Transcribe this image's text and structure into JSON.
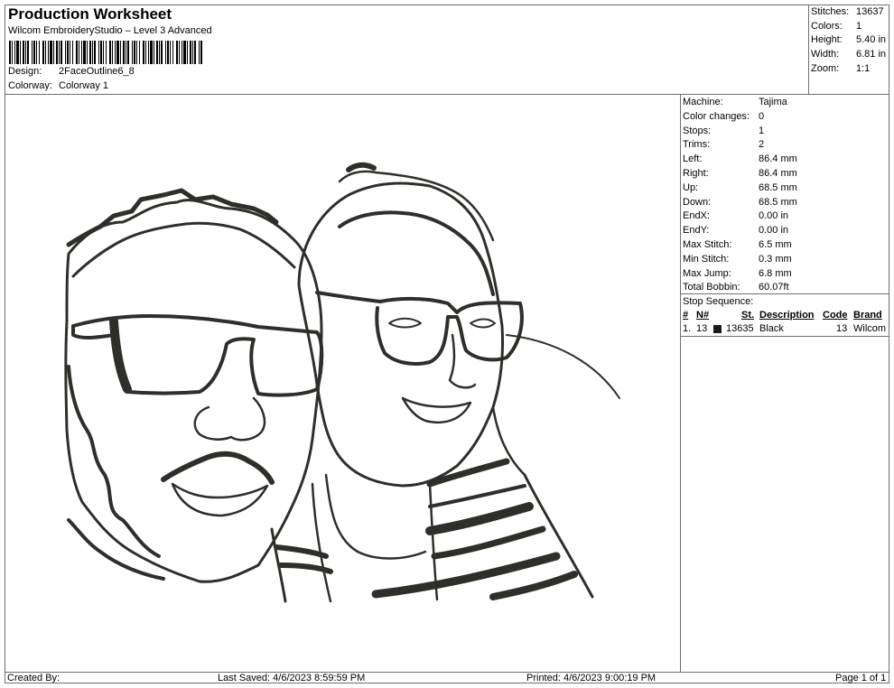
{
  "header": {
    "title": "Production Worksheet",
    "subtitle": "Wilcom EmbroideryStudio – Level 3 Advanced",
    "design_label": "Design:",
    "design_value": "2FaceOutline6_8",
    "colorway_label": "Colorway:",
    "colorway_value": "Colorway 1"
  },
  "summary": [
    {
      "label": "Stitches:",
      "value": "13637"
    },
    {
      "label": "Colors:",
      "value": "1"
    },
    {
      "label": "Height:",
      "value": "5.40 in"
    },
    {
      "label": "Width:",
      "value": "6.81 in"
    },
    {
      "label": "Zoom:",
      "value": "1:1"
    }
  ],
  "details": [
    {
      "label": "Machine:",
      "value": "Tajima"
    },
    {
      "label": "Color changes:",
      "value": "0"
    },
    {
      "label": "Stops:",
      "value": "1"
    },
    {
      "label": "Trims:",
      "value": "2"
    },
    {
      "label": "Left:",
      "value": "86.4 mm"
    },
    {
      "label": "Right:",
      "value": "86.4 mm"
    },
    {
      "label": "Up:",
      "value": "68.5 mm"
    },
    {
      "label": "Down:",
      "value": "68.5 mm"
    },
    {
      "label": "EndX:",
      "value": "0.00 in"
    },
    {
      "label": "EndY:",
      "value": "0.00 in"
    },
    {
      "label": "Max Stitch:",
      "value": "6.5 mm"
    },
    {
      "label": "Min Stitch:",
      "value": "0.3 mm"
    },
    {
      "label": "Max Jump:",
      "value": "6.8 mm"
    },
    {
      "label": "Total Bobbin:",
      "value": "60.07ft"
    }
  ],
  "stop_sequence": {
    "caption": "Stop Sequence:",
    "headers": {
      "num": "#",
      "n": "N#",
      "st": "St.",
      "desc": "Description",
      "code": "Code",
      "brand": "Brand"
    },
    "rows": [
      {
        "num": "1.",
        "n": "13",
        "swatch": "#1a1a1a",
        "st": "13635",
        "desc": "Black",
        "code": "13",
        "brand": "Wilcom"
      }
    ]
  },
  "footer": {
    "created_by": "Created By:",
    "last_saved": "Last Saved: 4/6/2023 8:59:59 PM",
    "printed": "Printed: 4/6/2023 9:00:19 PM",
    "page": "Page 1 of 1"
  },
  "artwork": {
    "description_icon": "embroidery-design-icon",
    "thread_color": "#2e2e2a"
  }
}
